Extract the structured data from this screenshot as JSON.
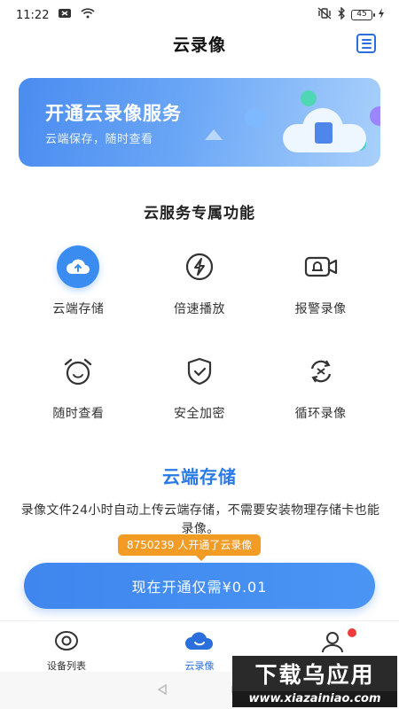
{
  "status_bar": {
    "time": "11:22",
    "battery": "45"
  },
  "header": {
    "title": "云录像"
  },
  "banner": {
    "title": "开通云录像服务",
    "subtitle": "云端保存，随时查看"
  },
  "section": {
    "title": "云服务专属功能"
  },
  "features": [
    {
      "label": "云端存储",
      "icon": "cloud-upload-icon"
    },
    {
      "label": "倍速播放",
      "icon": "lightning-icon"
    },
    {
      "label": "报警录像",
      "icon": "alarm-camera-icon"
    },
    {
      "label": "随时查看",
      "icon": "alarm-clock-icon"
    },
    {
      "label": "安全加密",
      "icon": "shield-check-icon"
    },
    {
      "label": "循环录像",
      "icon": "loop-icon"
    }
  ],
  "detail": {
    "title": "云端存储",
    "text": "录像文件24小时自动上传云端存储，不需要安装物理存储卡也能录像。"
  },
  "tooltip": {
    "text": "8750239 人开通了云录像"
  },
  "cta": {
    "label": "现在开通仅需¥0.01"
  },
  "tabbar": {
    "items": [
      {
        "label": "设备列表"
      },
      {
        "label": "云录像"
      },
      {
        "label": ""
      }
    ]
  },
  "watermark": {
    "brand": "下载乌应用",
    "url": "www.xiazainiao.com"
  },
  "colors": {
    "accent": "#2a6fdc",
    "primary_button": "#4a95f4",
    "tooltip": "#f29b25",
    "badge": "#f03c3c"
  }
}
